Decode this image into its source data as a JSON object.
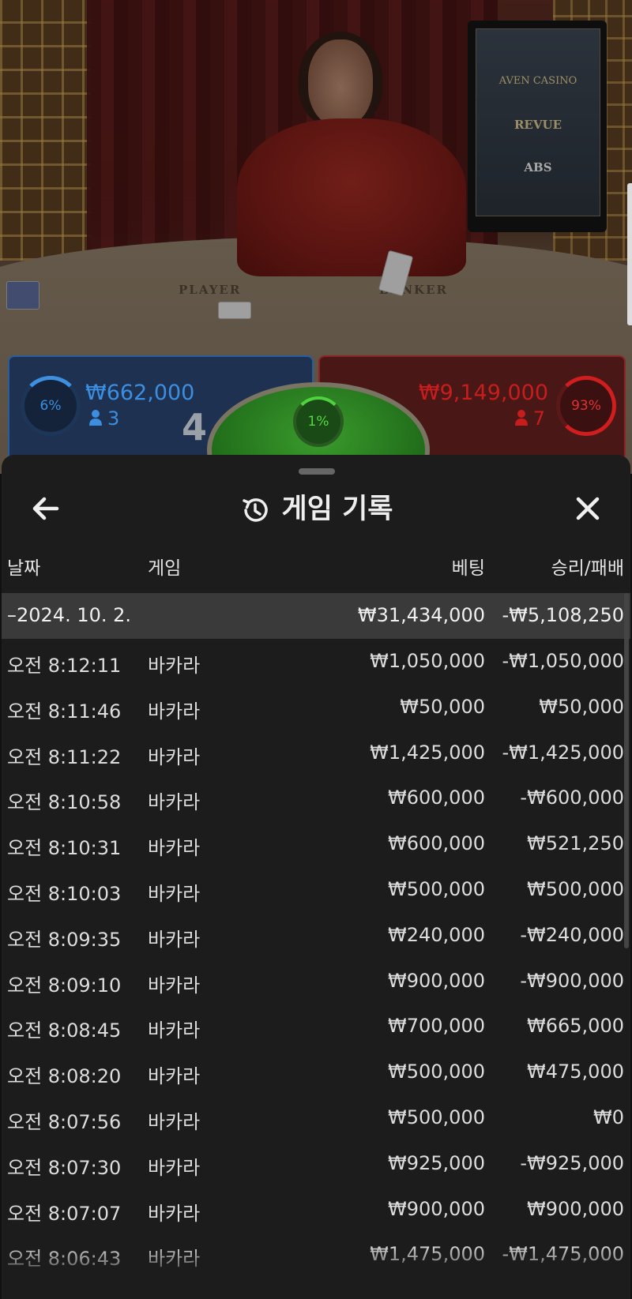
{
  "stage": {
    "table_labels": {
      "player": "PLAYER",
      "banker": "BANKER"
    },
    "screen_logos": [
      "AVEN CASINO",
      "REVUE",
      "ABS"
    ]
  },
  "bets": {
    "player": {
      "percent": "6%",
      "amount": "₩662,000",
      "players": "3",
      "score": "4",
      "color": "#3b8ee0"
    },
    "tie": {
      "percent": "1%",
      "color": "#55d842"
    },
    "banker": {
      "percent": "93%",
      "amount": "₩9,149,000",
      "players": "7",
      "color": "#c81d1d"
    }
  },
  "history": {
    "title": "게임 기록",
    "columns": {
      "date": "날짜",
      "game": "게임",
      "bet": "베팅",
      "winloss": "승리/패배"
    },
    "group": {
      "date": "–2024. 10. 2.",
      "bet": "₩31,434,000",
      "winloss": "-₩5,108,250"
    },
    "rows": [
      {
        "time": "오전 8:12:11",
        "game": "바카라",
        "bet": "₩1,050,000",
        "winloss": "-₩1,050,000"
      },
      {
        "time": "오전 8:11:46",
        "game": "바카라",
        "bet": "₩50,000",
        "winloss": "₩50,000"
      },
      {
        "time": "오전 8:11:22",
        "game": "바카라",
        "bet": "₩1,425,000",
        "winloss": "-₩1,425,000"
      },
      {
        "time": "오전 8:10:58",
        "game": "바카라",
        "bet": "₩600,000",
        "winloss": "-₩600,000"
      },
      {
        "time": "오전 8:10:31",
        "game": "바카라",
        "bet": "₩600,000",
        "winloss": "₩521,250"
      },
      {
        "time": "오전 8:10:03",
        "game": "바카라",
        "bet": "₩500,000",
        "winloss": "₩500,000"
      },
      {
        "time": "오전 8:09:35",
        "game": "바카라",
        "bet": "₩240,000",
        "winloss": "-₩240,000"
      },
      {
        "time": "오전 8:09:10",
        "game": "바카라",
        "bet": "₩900,000",
        "winloss": "-₩900,000"
      },
      {
        "time": "오전 8:08:45",
        "game": "바카라",
        "bet": "₩700,000",
        "winloss": "₩665,000"
      },
      {
        "time": "오전 8:08:20",
        "game": "바카라",
        "bet": "₩500,000",
        "winloss": "₩475,000"
      },
      {
        "time": "오전 8:07:56",
        "game": "바카라",
        "bet": "₩500,000",
        "winloss": "₩0"
      },
      {
        "time": "오전 8:07:30",
        "game": "바카라",
        "bet": "₩925,000",
        "winloss": "-₩925,000"
      },
      {
        "time": "오전 8:07:07",
        "game": "바카라",
        "bet": "₩900,000",
        "winloss": "₩900,000"
      },
      {
        "time": "오전 8:06:43",
        "game": "바카라",
        "bet": "₩1,475,000",
        "winloss": "-₩1,475,000"
      }
    ]
  },
  "icons": {
    "back": "arrow-left-icon",
    "history": "history-clock-icon",
    "close": "close-icon",
    "user": "user-icon"
  }
}
